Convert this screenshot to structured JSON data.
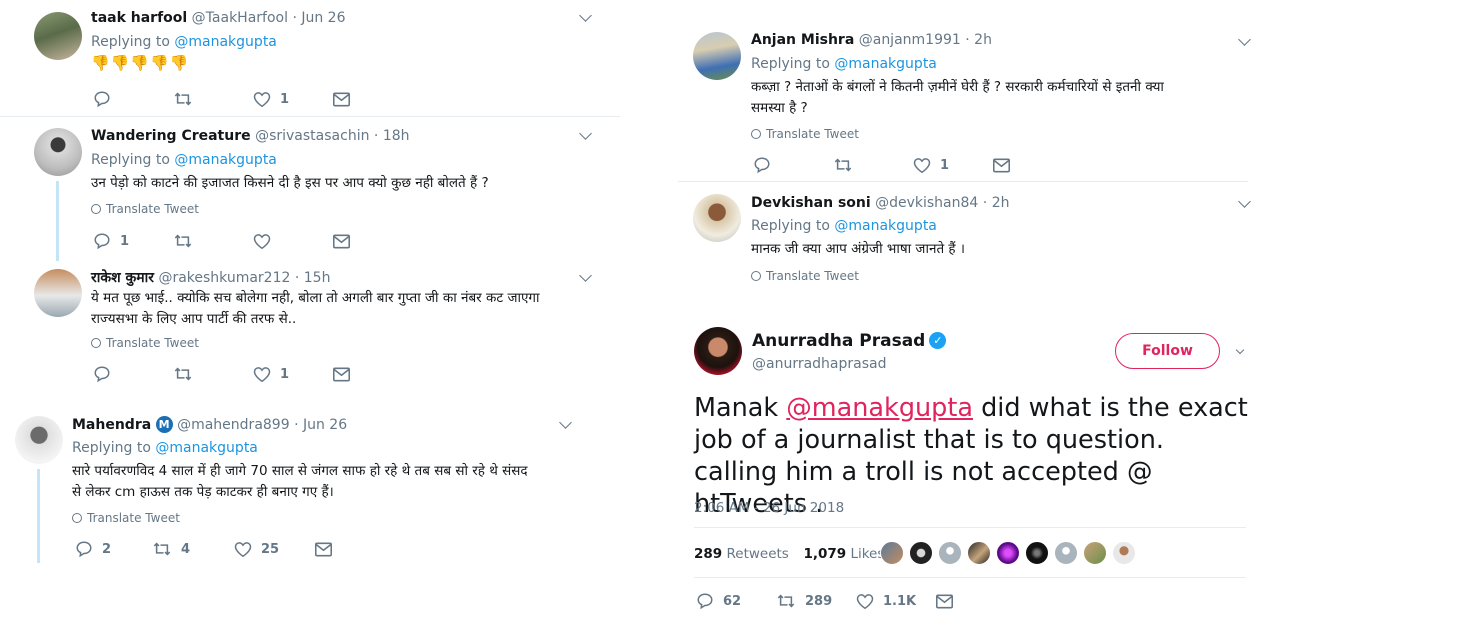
{
  "left_replies": [
    {
      "name": "taak harfool",
      "handle": "@TaakHarfool",
      "time": "Jun 26",
      "replying_label": "Replying to",
      "replying_handle": "@manakgupta",
      "thumbs": "👎👎👎👎👎",
      "counts": {
        "reply": "",
        "retweet": "",
        "like": "1"
      }
    },
    {
      "name": "Wandering Creature",
      "handle": "@srivastasachin",
      "time": "18h",
      "replying_label": "Replying to",
      "replying_handle": "@manakgupta",
      "text": "उन पेड़ो को काटने की इजाजत किसने दी है इस पर आप क्यो कुछ नही बोलते हैं ?",
      "translate": "Translate Tweet",
      "counts": {
        "reply": "1",
        "retweet": "",
        "like": ""
      }
    },
    {
      "name": "राकेश कुमार",
      "handle": "@rakeshkumar212",
      "time": "15h",
      "text_line1": "ये मत पूछ भाई.. क्योकि सच बोलेगा नही, बोला तो अगली बार गुप्ता जी का नंबर कट जाएगा",
      "text_line2": "राज्यसभा के लिए आप पार्टी की तरफ से..",
      "translate": "Translate Tweet",
      "counts": {
        "reply": "",
        "retweet": "",
        "like": "1"
      }
    },
    {
      "name": "Mahendra",
      "badge": "M",
      "handle": "@mahendra899",
      "time": "Jun 26",
      "replying_label": "Replying to",
      "replying_handle": "@manakgupta",
      "text_line1": "सारे पर्यावरणविद 4 साल में ही जागे 70 साल से जंगल साफ हो रहे थे तब सब सो रहे थे संसद",
      "text_line2": "से लेकर cm हाऊस तक पेड़ काटकर ही बनाए गए हैं।",
      "translate": "Translate Tweet",
      "counts": {
        "reply": "2",
        "retweet": "4",
        "like": "25"
      }
    }
  ],
  "right_replies": [
    {
      "name": "Anjan Mishra",
      "handle": "@anjanm1991",
      "time": "2h",
      "replying_label": "Replying to",
      "replying_handle": "@manakgupta",
      "text_line1": "कब्ज़ा ?  नेताओं के बंगलों ने कितनी ज़मीनें घेरी हैं ? सरकारी कर्मचारियों से इतनी क्या",
      "text_line2": "समस्या है ?",
      "translate": "Translate Tweet",
      "counts": {
        "reply": "",
        "retweet": "",
        "like": "1"
      }
    },
    {
      "name": "Devkishan soni",
      "handle": "@devkishan84",
      "time": "2h",
      "replying_label": "Replying to",
      "replying_handle": "@manakgupta",
      "text": "मानक जी क्या आप अंग्रेजी भाषा जानते हैं ।",
      "translate": "Translate Tweet"
    }
  ],
  "main_tweet": {
    "name": "Anurradha Prasad",
    "handle": "@anurradhaprasad",
    "follow_label": "Follow",
    "text_before": "Manak ",
    "mention": "@manakgupta",
    "text_after": " did what is the exact job of a journalist that is to question. calling him a troll is not accepted @ htTweets .",
    "timestamp": "2:06 AM - 26 Jun 2018",
    "retweets_count": "289",
    "retweets_label": "Retweets",
    "likes_count": "1,079",
    "likes_label": "Likes",
    "counts": {
      "reply": "62",
      "retweet": "289",
      "like": "1.1K"
    }
  },
  "colors": {
    "accent_blue": "#1b95e0",
    "mention_pink": "#e0245e",
    "muted": "#657786",
    "thread_line": "#c4e4f7"
  }
}
